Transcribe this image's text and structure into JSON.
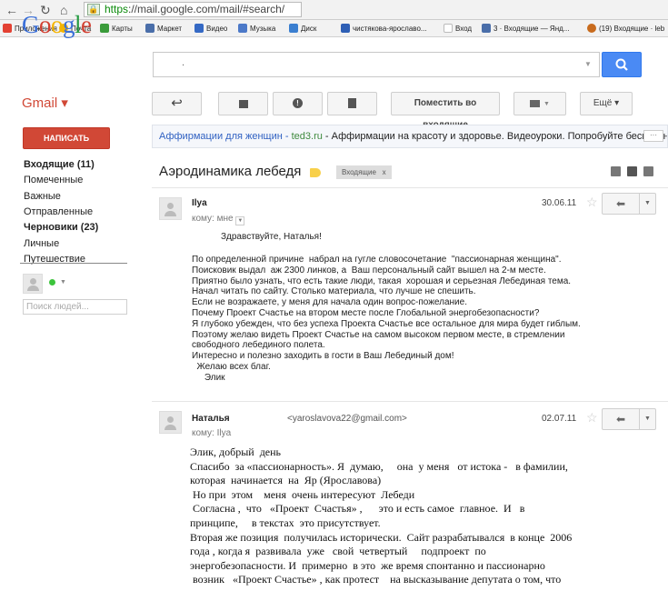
{
  "browser": {
    "url_https": "https",
    "url_rest": "://mail.google.com/mail/#search/"
  },
  "bookmarks": [
    {
      "label": "Приложения",
      "color": "#e34133"
    },
    {
      "label": "Почта",
      "color": "#f4b400"
    },
    {
      "label": "Карты",
      "color": "#3a9b3a"
    },
    {
      "label": "Маркет",
      "color": "#4a6ea9"
    },
    {
      "label": "Видео",
      "color": "#3569c4"
    },
    {
      "label": "Музыка",
      "color": "#4c79c8"
    },
    {
      "label": "Диск",
      "color": "#3b7fd0"
    },
    {
      "label": "чистякова-ярославо...",
      "color": "#2e5fb5"
    },
    {
      "label": "Вход",
      "color": "#d9d9d9"
    },
    {
      "label": "3 · Входящие — Янд...",
      "color": "#4a6ea9"
    },
    {
      "label": "(19) Входящие · leb",
      "color": "#c86b1d"
    }
  ],
  "google": {
    "logo_letters": [
      {
        "ch": "G",
        "color": "#3a6fd8"
      },
      {
        "ch": "o",
        "color": "#d23f31"
      },
      {
        "ch": "o",
        "color": "#f4b400"
      },
      {
        "ch": "g",
        "color": "#3a6fd8"
      },
      {
        "ch": "l",
        "color": "#249a41"
      },
      {
        "ch": "e",
        "color": "#d23f31"
      }
    ],
    "search_value": ".",
    "search_button_icon": "magnifier-icon"
  },
  "gmail": {
    "label": "Gmail ▾",
    "compose": "НАПИСАТЬ"
  },
  "toolbar": {
    "move_to_inbox": "Поместить во входящие",
    "more": "Ещё ▾"
  },
  "folders": [
    {
      "label": "Входящие (11)",
      "bold": true
    },
    {
      "label": "Помеченные",
      "bold": false
    },
    {
      "label": "Важные",
      "bold": false
    },
    {
      "label": "Отправленные",
      "bold": false
    },
    {
      "label": "Черновики (23)",
      "bold": true
    },
    {
      "label": "Личные",
      "bold": false
    },
    {
      "label": "Путешествие",
      "bold": false
    }
  ],
  "people": {
    "placeholder": "Поиск людей..."
  },
  "ad": {
    "link": "Аффирмации для женщин",
    "domain": "ted3.ru",
    "text": " - Аффирмации на красоту и здоровье. Видеоуроки. Попробуйте бесплатно!"
  },
  "thread": {
    "subject": "Аэродинамика лебедя",
    "label": "Входящие",
    "label_close": "x"
  },
  "message1": {
    "sender": "Ilya",
    "recipient": "кому: мне",
    "date": "30.06.11",
    "greeting": "Здравствуйте, Наталья!",
    "body": [
      "По определенной причине  набрал на гугле словосочетание  \"пассионарная женщина\".",
      "Поисковик выдал  аж 2300 линков, а  Ваш персональный сайт вышел на 2-м месте.",
      "Приятно было узнать, что есть такие люди, такая  хорошая и серьезная Лебединая тема.",
      "Начал читать по сайту. Столько материала, что лучше не спешить.",
      "Если не возражаете, у меня для начала один вопрос-пожелание.",
      "Почему Проект Счастье на втором месте после Глобальной энергобезопасности?",
      "Я глубоко убежден, что без успеха Проекта Счастье все остальное для мира будет гиблым.",
      "Поэтому желаю видеть Проект Счастье на самом высоком первом месте, в стремлении",
      "свободного лебединого полета.",
      "Интересно и полезно заходить в гости в Ваш Лебединый дом!",
      "  Желаю всех благ.",
      "     Элик"
    ]
  },
  "message2": {
    "sender": "Наталья",
    "sender_email": "<yaroslavova22@gmail.com>",
    "recipient": "кому: Ilya",
    "date": "02.07.11",
    "body": [
      "Элик, добрый  день",
      "Спасибо  за «пассионарность». Я  думаю,     она  у меня   от истока -   в фамилии,",
      "которая  начинается  на  Яр (Ярославова)",
      " Но при  этом    меня  очень интересуют  Лебеди",
      " Согласна ,  что   «Проект  Счастья» ,      это и есть самое  главное.  И   в",
      "принципе,     в текстах  это присутствует.",
      "Вторая же позиция  получилась исторически.  Сайт разрабатывался  в конце  2006",
      "года , когда я  развивала  уже   свой  четвертый     подпроект  по",
      "энергобезопасности. И  примерно  в это  же время спонтанно и пассионарно",
      " возник   «Проект Счастье» , как протест    на высказывание депутата о том, что"
    ]
  }
}
